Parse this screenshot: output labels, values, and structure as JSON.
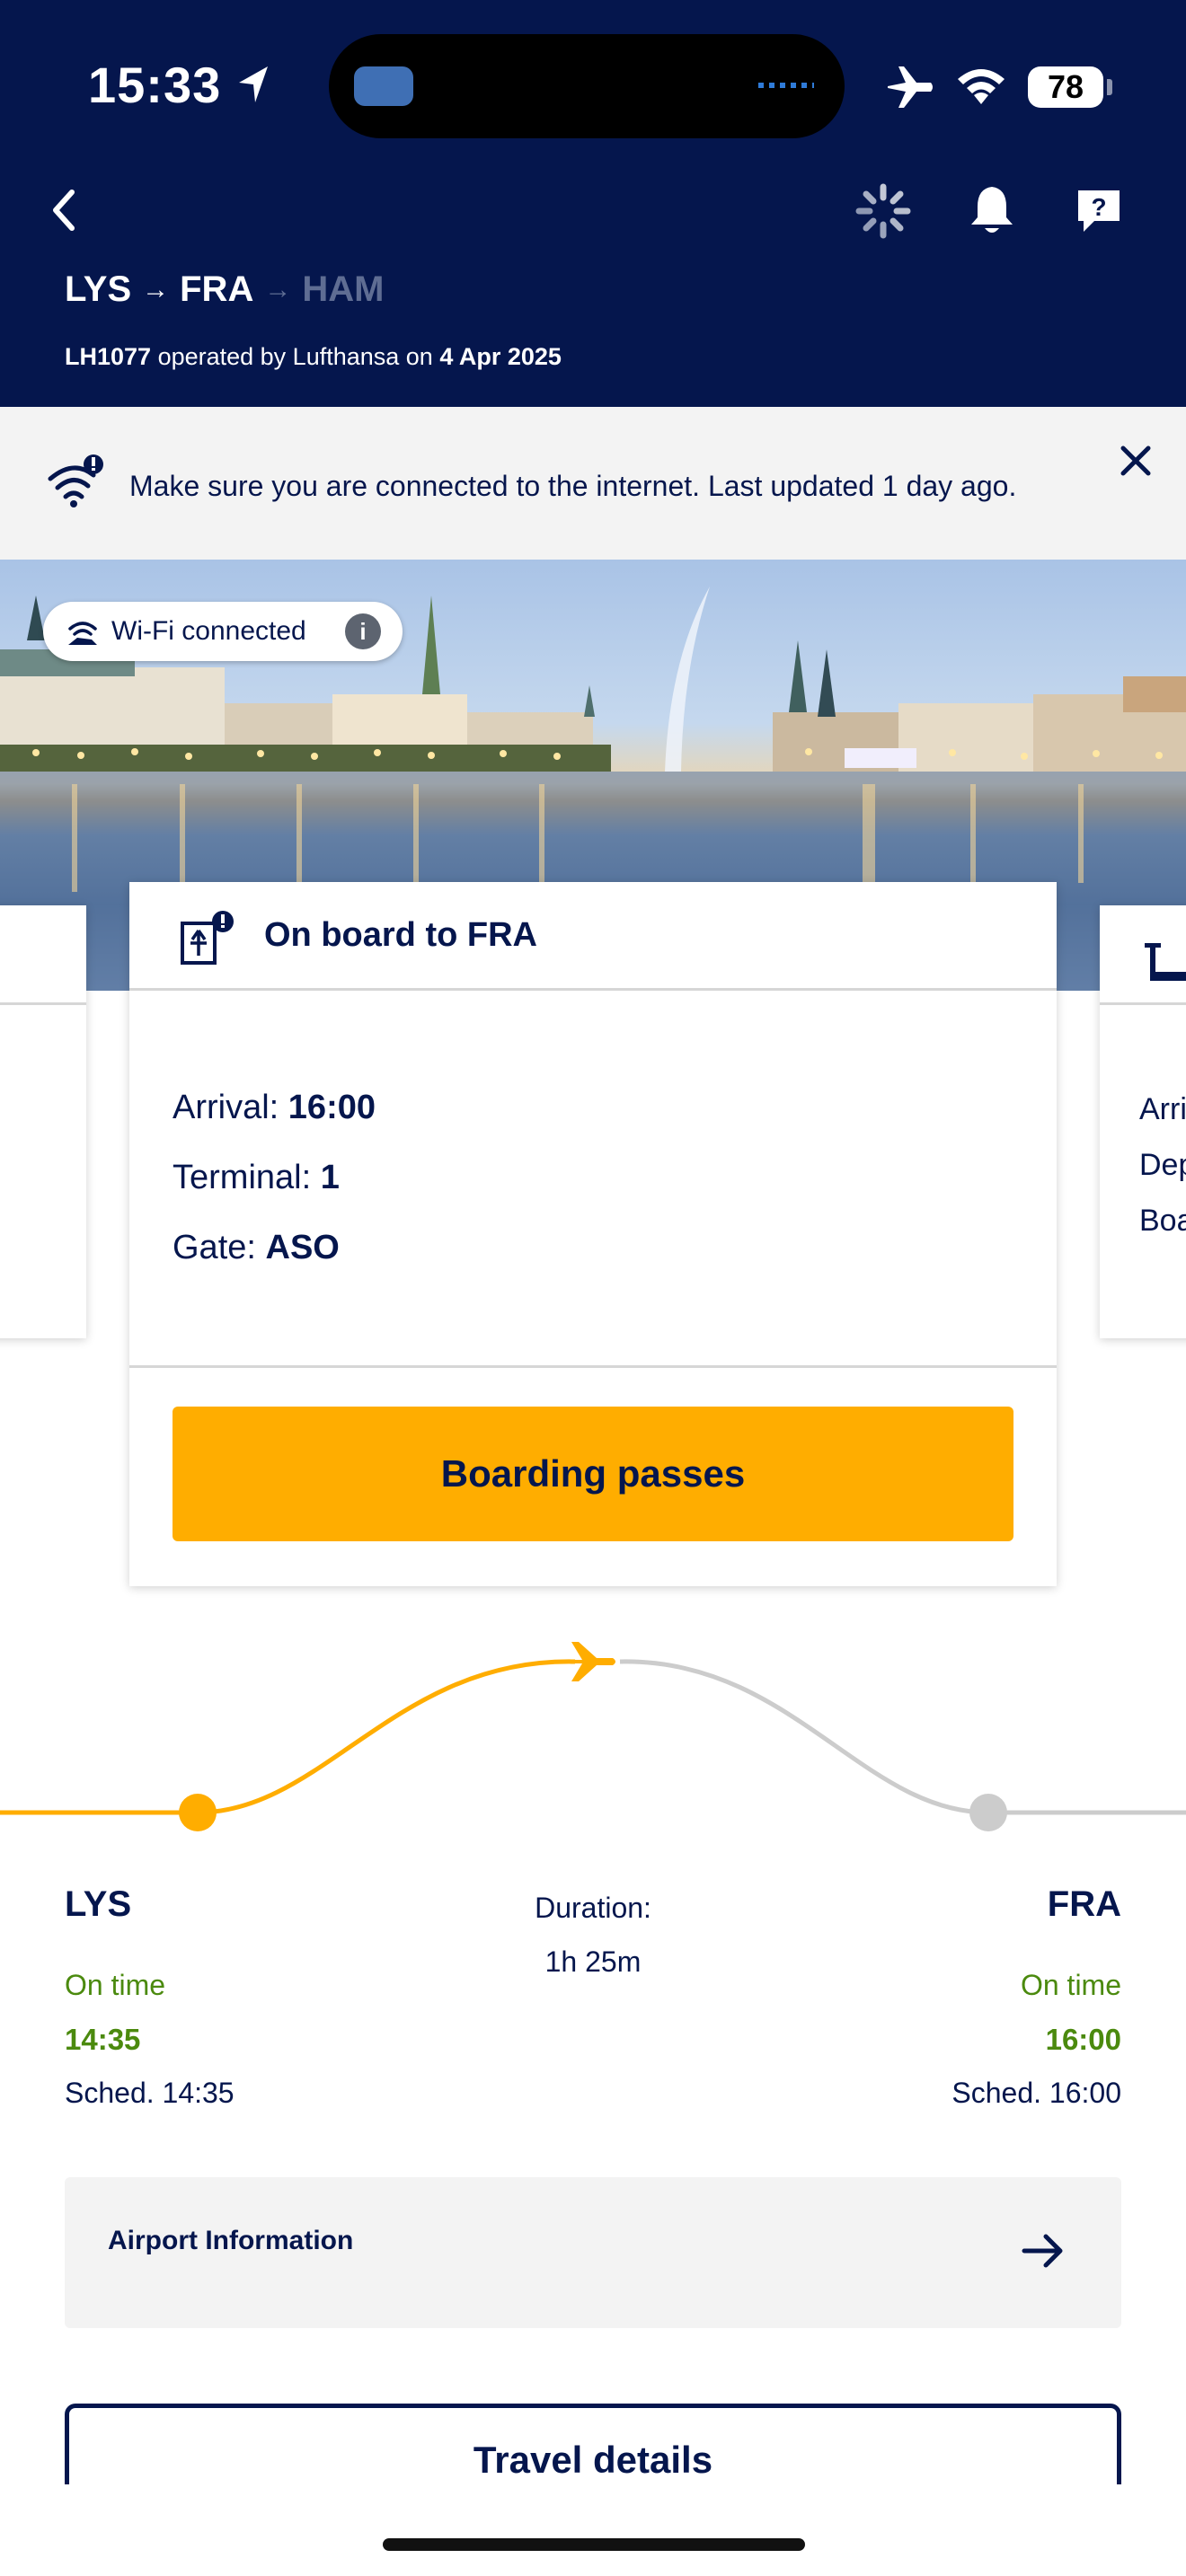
{
  "status_bar": {
    "time": "15:33",
    "battery": "78",
    "icons": [
      "location-arrow-icon",
      "airplane-mode-icon",
      "wifi-icon",
      "battery-icon"
    ]
  },
  "header": {
    "route": {
      "origin": "LYS",
      "stop": "FRA",
      "destination": "HAM",
      "arrow": "→"
    },
    "flight_number": "LH1077",
    "operated_text": " operated by Lufthansa on ",
    "date": "4 Apr 2025",
    "icons": [
      "back-chevron-icon",
      "loading-spinner-icon",
      "bell-icon",
      "help-icon"
    ]
  },
  "banner": {
    "message": "Make sure you are connected to the internet. Last updated 1 day ago."
  },
  "hero": {
    "wifi_label": "Wi-Fi connected",
    "info_glyph": "i"
  },
  "board_card": {
    "title": "On board to FRA",
    "arrival_label": "Arrival: ",
    "arrival_value": "16:00",
    "terminal_label": "Terminal: ",
    "terminal_value": "1",
    "gate_label": "Gate: ",
    "gate_value": "ASO",
    "button_label": "Boarding passes"
  },
  "next_card_peek": {
    "row1": "Arri",
    "row2": "Dep",
    "row3": "Boa"
  },
  "timeline": {
    "origin": {
      "code": "LYS",
      "status": "On time",
      "actual": "14:35",
      "scheduled": "Sched. 14:35"
    },
    "destination": {
      "code": "FRA",
      "status": "On time",
      "actual": "16:00",
      "scheduled": "Sched. 16:00"
    },
    "duration_label": "Duration:",
    "duration_value": "1h 25m",
    "colors": {
      "completed": "#ffad00",
      "remaining": "#cccccc"
    }
  },
  "airport_info": {
    "label": "Airport Information"
  },
  "travel_details": {
    "label": "Travel details"
  },
  "colors": {
    "navy": "#05164d",
    "yellow": "#ffad00",
    "green": "#4b8a0e",
    "grey_bg": "#f3f3f3"
  }
}
